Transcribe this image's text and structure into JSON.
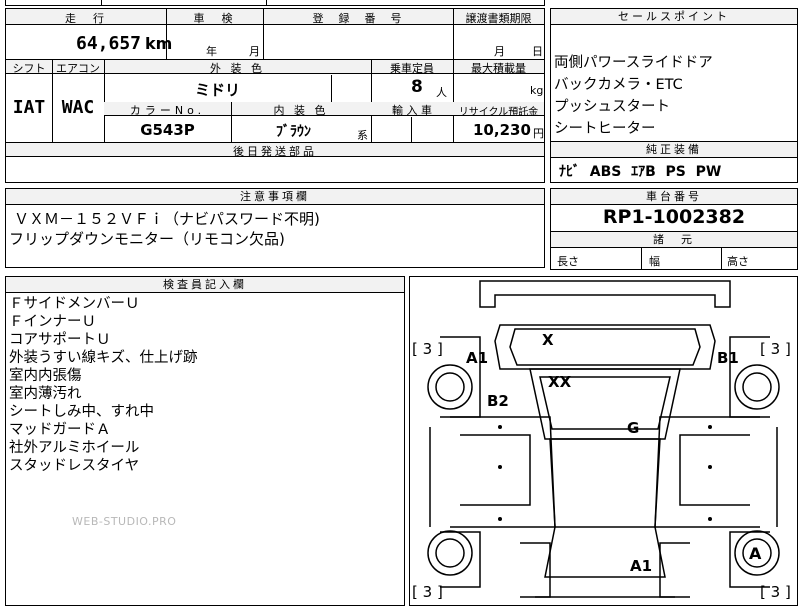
{
  "top_strip": {
    "partial_text": "…"
  },
  "vehicle_info": {
    "mileage_header": "走　行",
    "mileage_value": "64,657",
    "mileage_unit": "km",
    "inspection_header": "車　検",
    "inspection_year": "年",
    "inspection_month": "月",
    "registration_header": "登　録　番　号",
    "transfer_header": "譲渡書類期限",
    "transfer_month": "月",
    "transfer_day": "日",
    "shift_header": "シフト",
    "shift_value": "IAT",
    "ac_header": "エアコン",
    "ac_value": "WAC",
    "exterior_color_header": "外 装 色",
    "exterior_color_value": "ミドリ",
    "capacity_header": "乗車定員",
    "capacity_value": "8",
    "capacity_unit": "人",
    "max_load_header": "最大積載量",
    "max_load_unit": "kg",
    "color_no_header": "カラーNo.",
    "color_no_value": "G543P",
    "interior_color_header": "内 装 色",
    "interior_color_value": "ﾌﾞﾗｳﾝ",
    "interior_color_suffix": "系",
    "import_header": "輸 入 車",
    "recycle_header": "リサイクル預託金",
    "recycle_value": "10,230",
    "recycle_unit": "円",
    "delivery_header": "後日発送部品"
  },
  "sales_points": {
    "header": "セールスポイント",
    "items": [
      "両側パワースライドドア",
      "バックカメラ・ETC",
      "プッシュスタート",
      "シートヒーター"
    ]
  },
  "genuine_equipment": {
    "header": "純正装備",
    "value": "ﾅﾋﾞ  ABS  ｴｱB  PS  PW"
  },
  "notes": {
    "header": "注意事項欄",
    "lines": [
      "ＶＸＭ－１５２ＶＦｉ（ナビパスワード不明)",
      "フリップダウンモニター（リモコン欠品)"
    ]
  },
  "chassis": {
    "header": "車台番号",
    "value": "RP1-1002382"
  },
  "specs": {
    "header": "諸　元",
    "length": "長さ",
    "width": "幅",
    "height": "高さ"
  },
  "inspector": {
    "header": "検査員記入欄",
    "items": [
      "ＦサイドメンバーＵ",
      "ＦインナーＵ",
      "コアサポートＵ",
      "外装うすい線キズ、仕上げ跡",
      "室内内張傷",
      "室内薄汚れ",
      "シートしみ中、すれ中",
      "マッドガードＡ",
      "社外アルミホイール",
      "スタッドレスタイヤ"
    ]
  },
  "watermark": "WEB-STUDIO.PRO",
  "diagram": {
    "tire_left_top": "3",
    "tire_right_top": "3",
    "tire_left_bottom": "3",
    "tire_right_bottom": "3",
    "labels": {
      "a1_front_left": "A1",
      "b1_front_right": "B1",
      "b2": "B2",
      "x": "X",
      "xx": "XX",
      "g": "G",
      "a1_rear": "A1",
      "a_rear_wheel": "A"
    }
  }
}
